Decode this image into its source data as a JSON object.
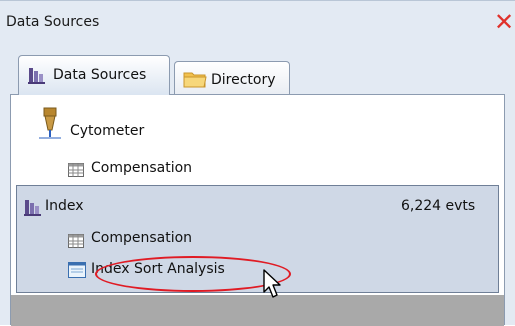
{
  "window": {
    "title": "Data Sources",
    "close_icon": "close-x-icon"
  },
  "tabs": [
    {
      "label": "Data Sources",
      "icon": "data-sources-icon",
      "active": true
    },
    {
      "label": "Directory",
      "icon": "folder-icon",
      "active": false
    }
  ],
  "tree": {
    "cytometer": {
      "label": "Cytometer",
      "icon": "cytometer-nozzle-icon",
      "children": [
        {
          "label": "Compensation",
          "icon": "grid-table-icon"
        }
      ]
    },
    "index": {
      "label": "Index",
      "icon": "data-sources-icon",
      "count": "6,224 evts",
      "selected": true,
      "children": [
        {
          "label": "Compensation",
          "icon": "grid-table-icon"
        },
        {
          "label": "Index Sort Analysis",
          "icon": "worksheet-icon",
          "highlighted": true
        }
      ]
    }
  },
  "colors": {
    "close": "#e0312b",
    "highlight_ring": "#e01b24",
    "selection_bg": "#cfd8e6",
    "empty_area": "#a9a9a9"
  }
}
